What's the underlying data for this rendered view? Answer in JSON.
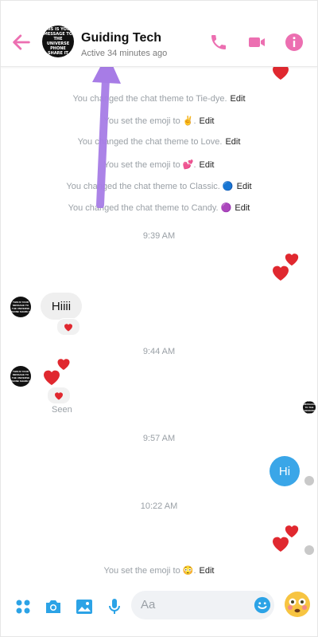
{
  "header": {
    "contact_name": "Guiding Tech",
    "status": "Active 34 minutes ago",
    "avatar_text": "THIS IS YOUR MESSAGE TO THE UNIVERSE PHONE SHARE IT"
  },
  "system_messages": [
    {
      "text": "You changed the chat theme to Tie-dye.",
      "edit": "Edit"
    },
    {
      "text": "You set the emoji to ✌️.",
      "edit": "Edit"
    },
    {
      "text": "You changed the chat theme to Love.",
      "edit": "Edit"
    },
    {
      "text": "You set the emoji to 💕.",
      "edit": "Edit"
    },
    {
      "text": "You changed the chat theme to Classic. 🔵",
      "edit": "Edit"
    },
    {
      "text": "You changed the chat theme to Candy. 🟣",
      "edit": "Edit"
    },
    {
      "text": "You set the emoji to 😳.",
      "edit": "Edit"
    }
  ],
  "timestamps": [
    "9:39 AM",
    "9:44 AM",
    "9:57 AM",
    "10:22 AM"
  ],
  "messages": {
    "incoming_1": "Hiiii",
    "outgoing_1": "Hi",
    "seen_label": "Seen"
  },
  "composer": {
    "placeholder": "Aa",
    "icons": [
      "apps-icon",
      "camera-icon",
      "gallery-icon",
      "microphone-icon",
      "emoji-picker-icon",
      "flushed-emoji-icon"
    ]
  },
  "colors": {
    "accent": "#ec6fb1",
    "outgoing_bubble": "#3aa6e8",
    "heart": "#e0282f",
    "annotation_arrow": "#a77ce6"
  },
  "header_icons": [
    "back-arrow-icon",
    "phone-icon",
    "video-icon",
    "info-icon"
  ]
}
